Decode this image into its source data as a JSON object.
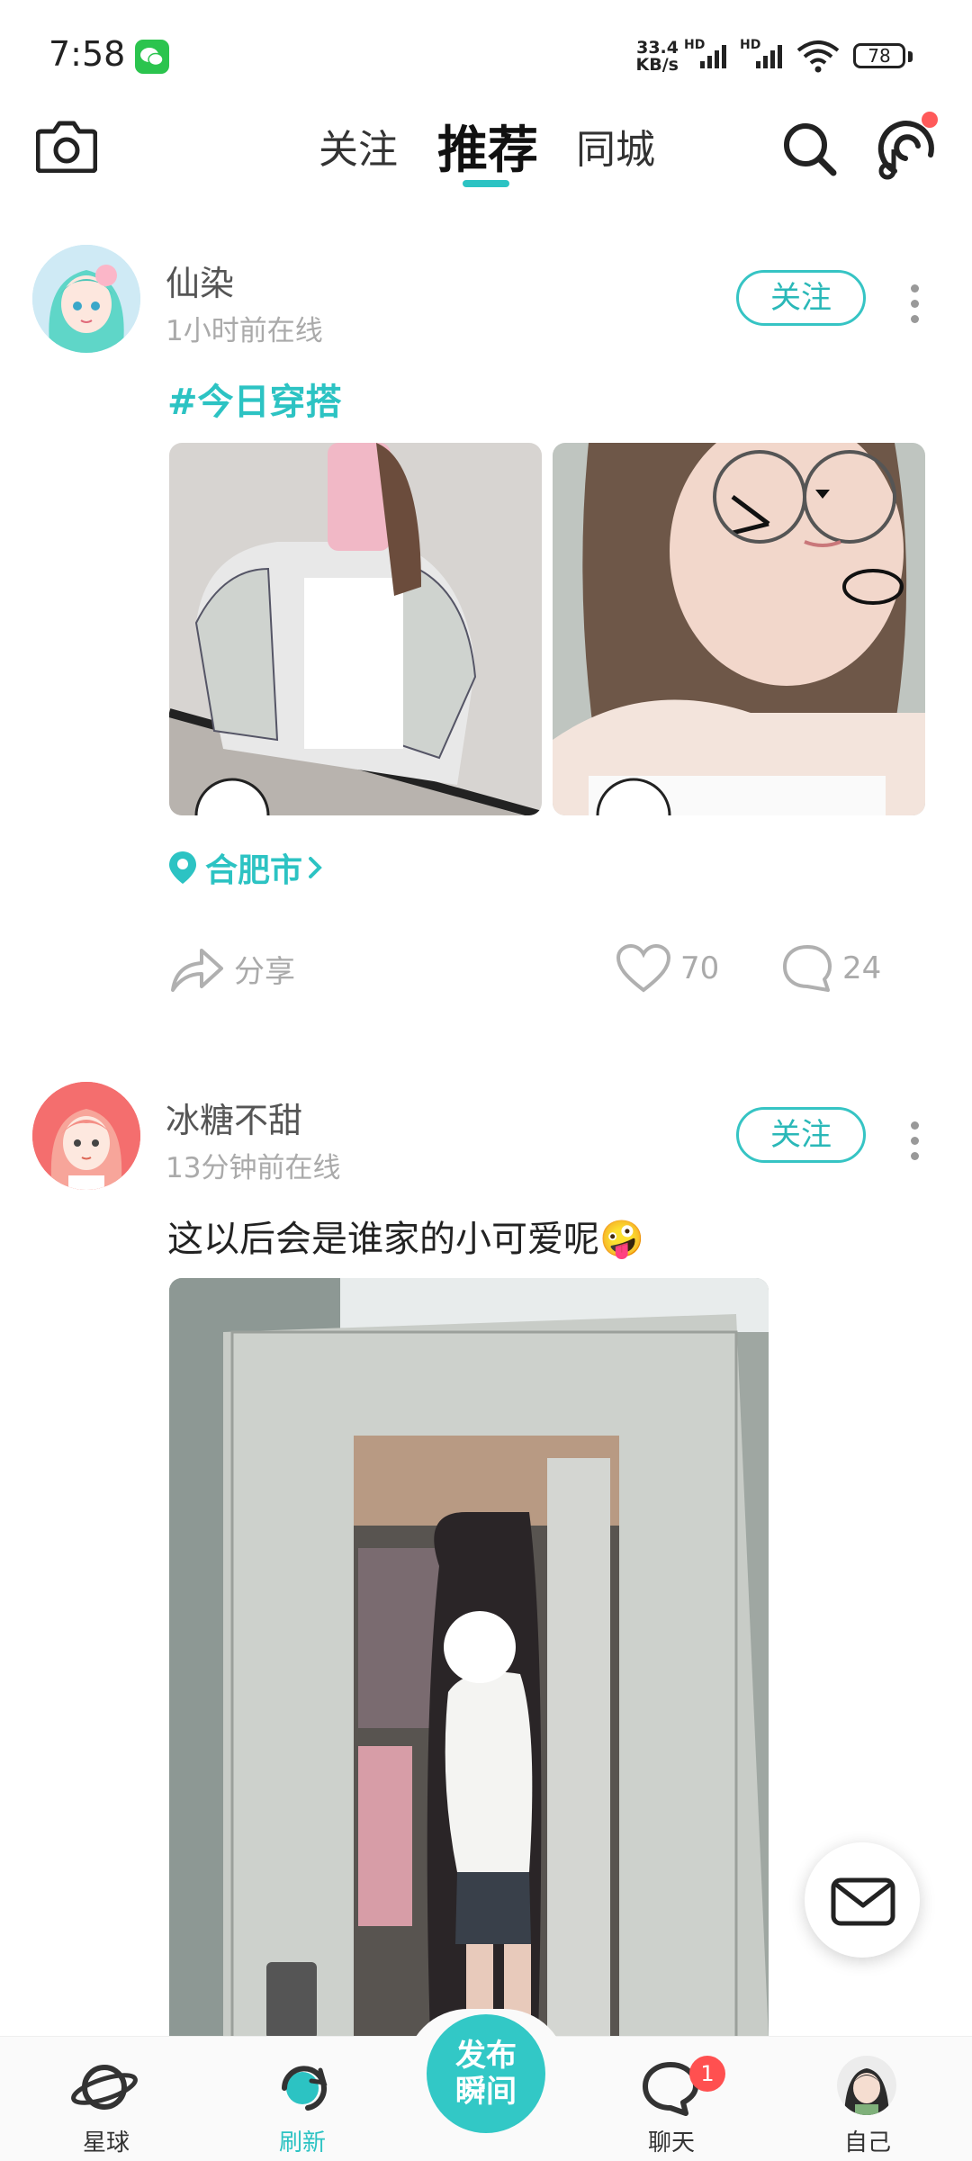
{
  "status_bar": {
    "time": "7:58",
    "net_speed_value": "33.4",
    "net_speed_unit": "KB/s",
    "hd1": "HD",
    "hd2": "HD",
    "battery": "78"
  },
  "header": {
    "tabs": [
      {
        "label": "关注"
      },
      {
        "label": "推荐"
      },
      {
        "label": "同城"
      }
    ],
    "active_tab": "推荐"
  },
  "posts": [
    {
      "username": "仙染",
      "online": "1小时前在线",
      "follow_label": "关注",
      "hashtag": "#今日穿搭",
      "location": "合肥市",
      "share_label": "分享",
      "likes": "70",
      "comments": "24"
    },
    {
      "username": "冰糖不甜",
      "online": "13分钟前在线",
      "follow_label": "关注",
      "text": "这以后会是谁家的小可爱呢🤪"
    }
  ],
  "bottom_nav": {
    "items": [
      {
        "label": "星球",
        "icon": "planet-icon"
      },
      {
        "label": "刷新",
        "icon": "refresh-icon"
      },
      {
        "label": "聊天",
        "icon": "chat-icon"
      },
      {
        "label": "自己",
        "icon": "avatar"
      }
    ],
    "publish_line1": "发布",
    "publish_line2": "瞬间",
    "chat_badge": "1"
  },
  "colors": {
    "accent": "#2cc3c3",
    "badge_red": "#ff5050",
    "text_gray": "#aaaaaa"
  }
}
